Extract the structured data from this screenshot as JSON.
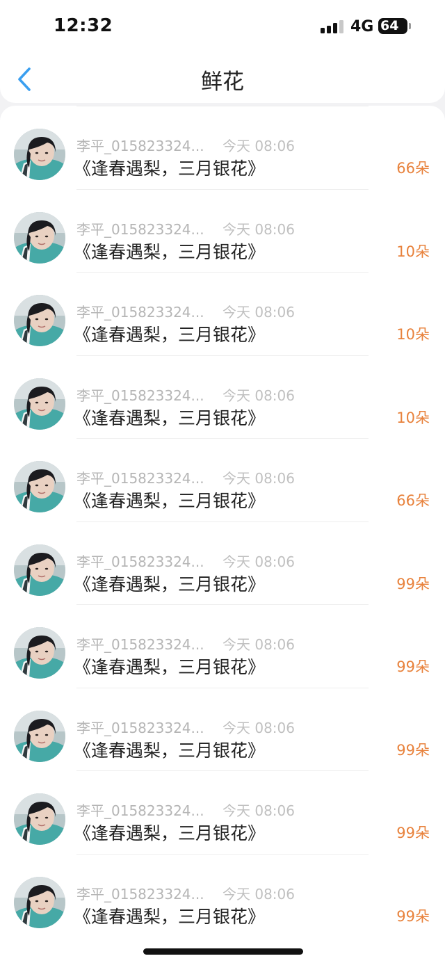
{
  "status_bar": {
    "time": "12:32",
    "network": "4G",
    "battery": "64"
  },
  "header": {
    "title": "鲜花",
    "back_icon": "chevron-left-icon"
  },
  "colors": {
    "accent_back": "#3a9ff0",
    "count_orange": "#e8823c",
    "meta_gray": "#b5b5b5"
  },
  "items": [
    {
      "sender": "李平_015823324...",
      "time": "今天 08:06",
      "title": "《逢春遇梨，三月银花》",
      "count": "66朵"
    },
    {
      "sender": "李平_015823324...",
      "time": "今天 08:06",
      "title": "《逢春遇梨，三月银花》",
      "count": "10朵"
    },
    {
      "sender": "李平_015823324...",
      "time": "今天 08:06",
      "title": "《逢春遇梨，三月银花》",
      "count": "10朵"
    },
    {
      "sender": "李平_015823324...",
      "time": "今天 08:06",
      "title": "《逢春遇梨，三月银花》",
      "count": "10朵"
    },
    {
      "sender": "李平_015823324...",
      "time": "今天 08:06",
      "title": "《逢春遇梨，三月银花》",
      "count": "66朵"
    },
    {
      "sender": "李平_015823324...",
      "time": "今天 08:06",
      "title": "《逢春遇梨，三月银花》",
      "count": "99朵"
    },
    {
      "sender": "李平_015823324...",
      "time": "今天 08:06",
      "title": "《逢春遇梨，三月银花》",
      "count": "99朵"
    },
    {
      "sender": "李平_015823324...",
      "time": "今天 08:06",
      "title": "《逢春遇梨，三月银花》",
      "count": "99朵"
    },
    {
      "sender": "李平_015823324...",
      "time": "今天 08:06",
      "title": "《逢春遇梨，三月银花》",
      "count": "99朵"
    },
    {
      "sender": "李平_015823324...",
      "time": "今天 08:06",
      "title": "《逢春遇梨，三月银花》",
      "count": "99朵"
    }
  ]
}
